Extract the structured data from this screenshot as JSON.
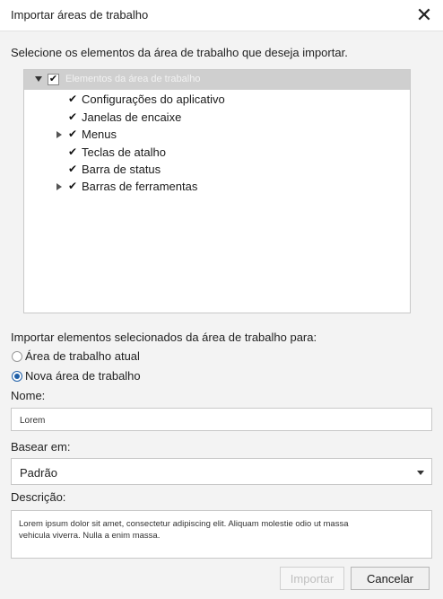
{
  "dialog": {
    "title": "Importar áreas de trabalho",
    "close_glyph": "✕",
    "instruction": "Selecione os elementos da área de trabalho que deseja importar.",
    "tree": {
      "root_label": "Elementos da área de trabalho",
      "items": [
        {
          "label": "Configurações do aplicativo",
          "checked": true,
          "expandable": false
        },
        {
          "label": "Janelas de encaixe",
          "checked": true,
          "expandable": false
        },
        {
          "label": "Menus",
          "checked": true,
          "expandable": true
        },
        {
          "label": "Teclas de atalho",
          "checked": true,
          "expandable": false
        },
        {
          "label": "Barra de status",
          "checked": true,
          "expandable": false
        },
        {
          "label": "Barras de ferramentas",
          "checked": true,
          "expandable": true
        }
      ]
    },
    "import_to_label": "Importar elementos selecionados da área de trabalho para:",
    "options": {
      "current": "Área de trabalho atual",
      "new": "Nova área de trabalho",
      "selected": "new"
    },
    "name_label": "Nome:",
    "name_value": "Lorem",
    "base_label": "Basear em:",
    "base_value": "Padrão",
    "description_label": "Descrição:",
    "description_value": "Lorem ipsum dolor sit amet, consectetur adipiscing elit. Aliquam molestie odio ut massa vehicula viverra. Nulla a enim massa.",
    "buttons": {
      "import": "Importar",
      "cancel": "Cancelar"
    },
    "colors": {
      "radio_selected": "#1f5fa8",
      "tree_root_bg": "#cfcfcf"
    }
  }
}
